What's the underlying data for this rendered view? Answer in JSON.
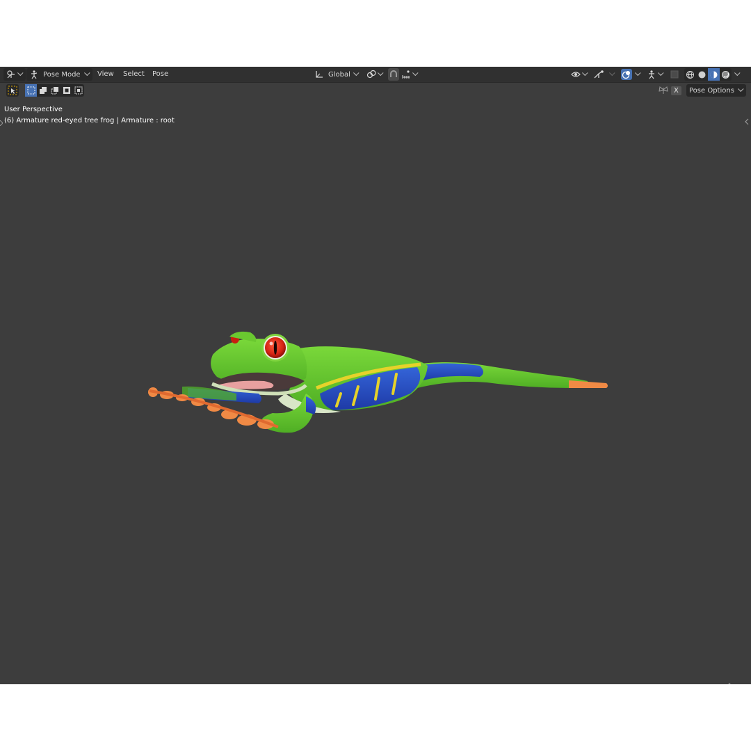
{
  "header": {
    "mode_label": "Pose Mode",
    "menus": [
      "View",
      "Select",
      "Pose"
    ],
    "transform_orientation": "Global"
  },
  "toolbar": {
    "pose_options_label": "Pose Options",
    "mirror_label": "X"
  },
  "viewport": {
    "view_name": "User Perspective",
    "object_info": "(6) Armature red-eyed tree frog | Armature : root"
  },
  "icons": {
    "editor_type": "view3d-icon",
    "mode": "pose-mode-icon",
    "orientation": "transform-orientation-icon",
    "pivot": "pivot-icon",
    "snap": "snap-icon",
    "snap_target": "snap-increment-icon",
    "visibility": "visibility-icon",
    "gizmo": "gizmo-icon",
    "overlay": "overlay-icon",
    "xray": "xray-icon",
    "shading_wire": "wireframe-shading-icon",
    "shading_solid": "solid-shading-icon",
    "shading_material": "material-shading-icon",
    "shading_rendered": "rendered-shading-icon"
  },
  "colors": {
    "viewport_bg": "#3d3d3d",
    "header_bg": "#303030",
    "accent": "#4772b3",
    "frog_green": "#5cc42e",
    "frog_blue": "#2852c8",
    "frog_yellow": "#e6d22a",
    "frog_orange": "#f08a45",
    "eye_red": "#d42414"
  }
}
